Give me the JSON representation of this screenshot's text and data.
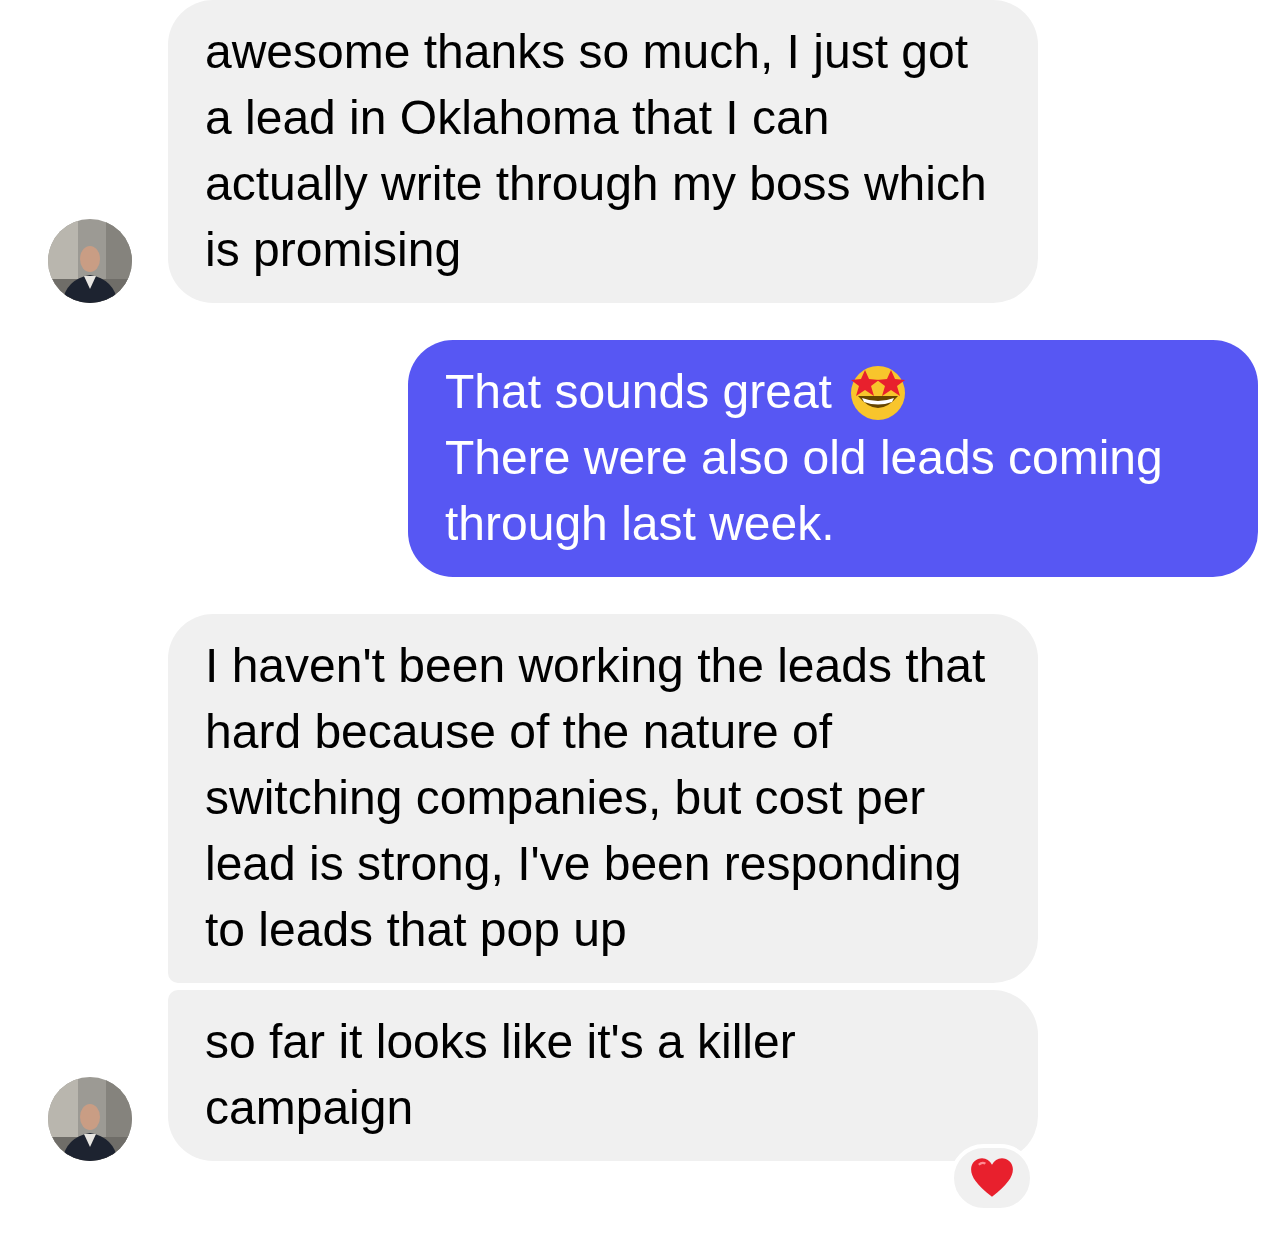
{
  "messages": [
    {
      "kind": "incoming",
      "lines": [
        "awesome thanks so much, I just got a lead in Oklahoma that I can actually write through my boss which is promising"
      ],
      "avatar": true,
      "reacted": false
    },
    {
      "kind": "outgoing",
      "lines": [
        "That sounds great",
        "There were also old leads coming through last week."
      ]
    },
    {
      "kind": "incoming",
      "lines": [
        "I haven't been working the leads that hard because of the nature of switching companies, but cost per lead is strong, I've been responding to leads that pop up"
      ],
      "avatar": false,
      "reacted": false
    },
    {
      "kind": "incoming",
      "lines": [
        "so far it looks like it's a killer campaign"
      ],
      "avatar": true,
      "reacted": true
    }
  ]
}
